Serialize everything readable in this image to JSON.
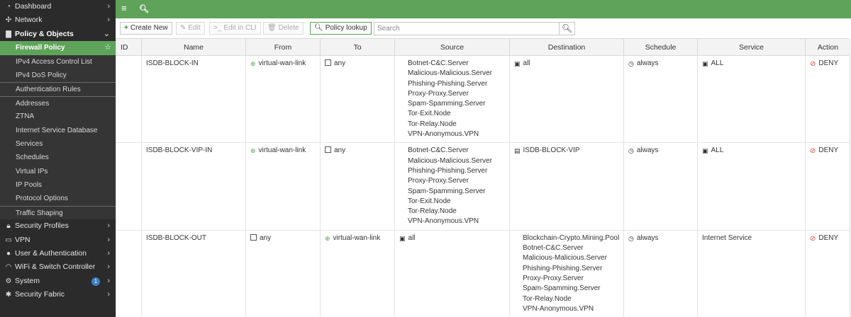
{
  "sidebar": {
    "items": [
      {
        "label": "Dashboard",
        "icon": "dashboard-icon",
        "glyph": "◔",
        "chevron": "›"
      },
      {
        "label": "Network",
        "icon": "network-icon",
        "glyph": "✣",
        "chevron": "›"
      },
      {
        "label": "Policy & Objects",
        "icon": "policy-icon",
        "glyph": "▇",
        "chevron": "⌄"
      }
    ],
    "policy_subitems": [
      {
        "label": "Firewall Policy",
        "active": true,
        "star": "☆"
      },
      {
        "label": "IPv4 Access Control List"
      },
      {
        "label": "IPv4 DoS Policy"
      },
      {
        "label": "Authentication Rules"
      },
      {
        "label": "Addresses"
      },
      {
        "label": "ZTNA"
      },
      {
        "label": "Internet Service Database"
      },
      {
        "label": "Services"
      },
      {
        "label": "Schedules"
      },
      {
        "label": "Virtual IPs"
      },
      {
        "label": "IP Pools"
      },
      {
        "label": "Protocol Options"
      },
      {
        "label": "Traffic Shaping"
      }
    ],
    "bottom_items": [
      {
        "label": "Security Profiles",
        "icon": "lock-icon",
        "glyph": "🔒︎",
        "chevron": "›"
      },
      {
        "label": "VPN",
        "icon": "vpn-icon",
        "glyph": "▭",
        "chevron": "›"
      },
      {
        "label": "User & Authentication",
        "icon": "user-icon",
        "glyph": "●",
        "chevron": "›"
      },
      {
        "label": "WiFi & Switch Controller",
        "icon": "wifi-icon",
        "glyph": "◠",
        "chevron": "›"
      },
      {
        "label": "System",
        "icon": "gear-icon",
        "glyph": "⚙",
        "chevron": "›",
        "badge": "1"
      },
      {
        "label": "Security Fabric",
        "icon": "fabric-icon",
        "glyph": "✱",
        "chevron": "›"
      }
    ]
  },
  "topbar": {
    "menu_glyph": "≡",
    "search_glyph": "🔍︎"
  },
  "toolbar": {
    "create_new": "Create New",
    "create_glyph": "+",
    "edit": "Edit",
    "edit_glyph": "✎",
    "edit_cli": "Edit in CLI",
    "edit_cli_glyph": ">_",
    "delete": "Delete",
    "delete_glyph": "🗑︎",
    "policy_lookup": "Policy lookup",
    "policy_lookup_glyph": "🔍︎",
    "search_placeholder": "Search",
    "search_glyph": "🔍︎"
  },
  "table": {
    "columns": [
      "ID",
      "Name",
      "From",
      "To",
      "Source",
      "Destination",
      "Schedule",
      "Service",
      "Action"
    ],
    "rows": [
      {
        "name": "ISDB-BLOCK-IN",
        "from": "virtual-wan-link",
        "to": "any",
        "source": [
          "Botnet-C&C.Server",
          "Malicious-Malicious.Server",
          "Phishing-Phishing.Server",
          "Proxy-Proxy.Server",
          "Spam-Spamming.Server",
          "Tor-Exit.Node",
          "Tor-Relay.Node",
          "VPN-Anonymous.VPN"
        ],
        "destination": [
          "all"
        ],
        "schedule": "always",
        "service": "ALL",
        "action": "DENY"
      },
      {
        "name": "ISDB-BLOCK-VIP-IN",
        "from": "virtual-wan-link",
        "to": "any",
        "source": [
          "Botnet-C&C.Server",
          "Malicious-Malicious.Server",
          "Phishing-Phishing.Server",
          "Proxy-Proxy.Server",
          "Spam-Spamming.Server",
          "Tor-Exit.Node",
          "Tor-Relay.Node",
          "VPN-Anonymous.VPN"
        ],
        "destination": [
          "ISDB-BLOCK-VIP"
        ],
        "schedule": "always",
        "service": "ALL",
        "action": "DENY"
      },
      {
        "name": "ISDB-BLOCK-OUT",
        "from": "any",
        "to": "virtual-wan-link",
        "source": [
          "all"
        ],
        "destination": [
          "Blockchain-Crypto.Mining.Pool",
          "Botnet-C&C.Server",
          "Malicious-Malicious.Server",
          "Phishing-Phishing.Server",
          "Proxy-Proxy.Server",
          "Spam-Spamming.Server",
          "Tor-Relay.Node",
          "VPN-Anonymous.VPN"
        ],
        "schedule": "always",
        "service": "Internet Service",
        "action": "DENY"
      }
    ]
  },
  "colors": {
    "accent": "#5fa35b",
    "sidebar_bg": "#2b2b2b",
    "deny": "#d04a3c"
  }
}
